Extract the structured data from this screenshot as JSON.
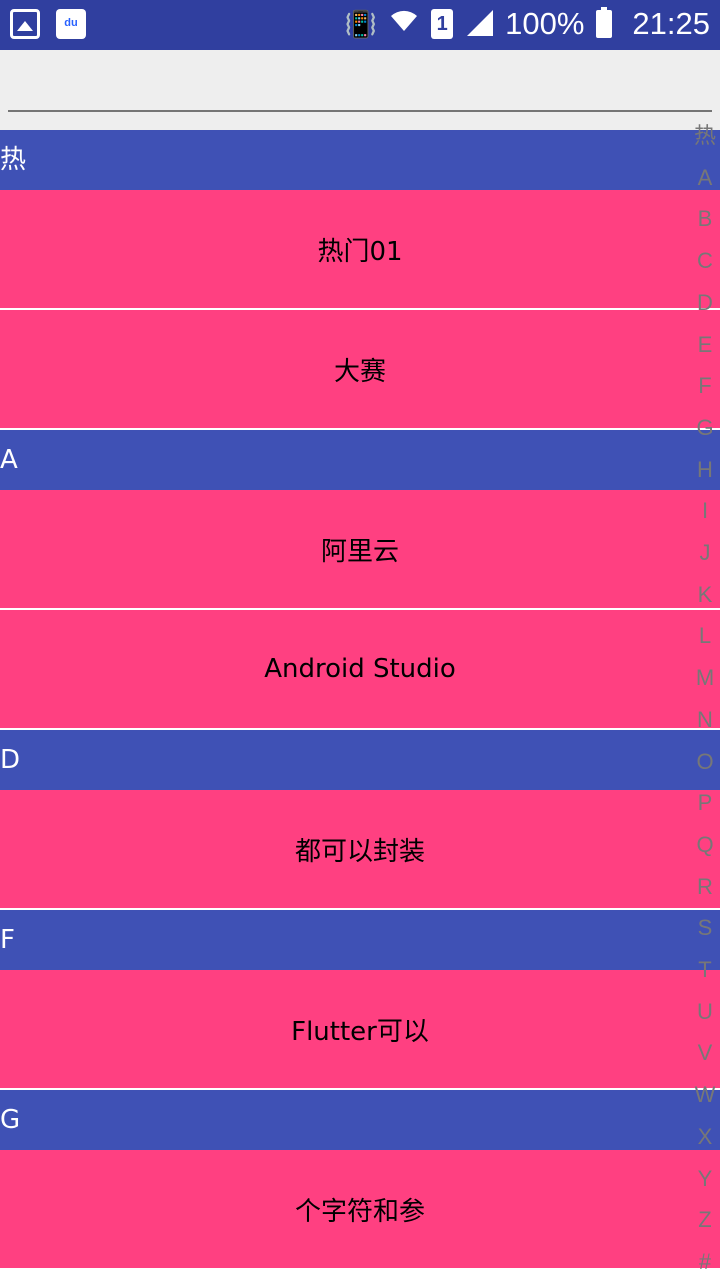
{
  "statusbar": {
    "battery_percent": "100%",
    "time": "21:25",
    "sim_slot": "1",
    "icons": [
      "gallery-icon",
      "baidu-icon",
      "vibrate-icon",
      "wifi-icon",
      "sim-icon",
      "signal-icon",
      "battery-icon"
    ]
  },
  "search": {
    "value": "",
    "placeholder": ""
  },
  "sections": [
    {
      "header": "热",
      "items": [
        "热门01",
        "大赛"
      ]
    },
    {
      "header": "A",
      "items": [
        "阿里云",
        "Android Studio"
      ]
    },
    {
      "header": "D",
      "items": [
        "都可以封装"
      ]
    },
    {
      "header": "F",
      "items": [
        "Flutter可以"
      ]
    },
    {
      "header": "G",
      "items": [
        "个字符和参"
      ]
    }
  ],
  "index_letters": [
    "热",
    "A",
    "B",
    "C",
    "D",
    "E",
    "F",
    "G",
    "H",
    "I",
    "J",
    "K",
    "L",
    "M",
    "N",
    "O",
    "P",
    "Q",
    "R",
    "S",
    "T",
    "U",
    "V",
    "W",
    "X",
    "Y",
    "Z",
    "#"
  ],
  "colors": {
    "statusbar": "#303f9f",
    "header": "#3f51b5",
    "row": "#ff4081",
    "index_text": "#777777"
  }
}
